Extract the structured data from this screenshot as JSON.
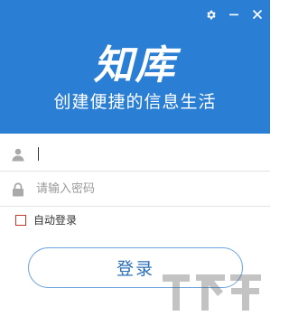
{
  "header": {
    "logo": "知库",
    "slogan": "创建便捷的信息生活",
    "bg_color": "#2a7fd4"
  },
  "window_controls": {
    "settings_icon": "gear-icon",
    "minimize_icon": "minus-icon",
    "close_icon": "close-icon"
  },
  "form": {
    "username": {
      "value": "",
      "placeholder": ""
    },
    "password": {
      "value": "",
      "placeholder": "请输入密码"
    },
    "auto_login_label": "自动登录",
    "auto_login_checked": false,
    "login_button": "登录"
  }
}
